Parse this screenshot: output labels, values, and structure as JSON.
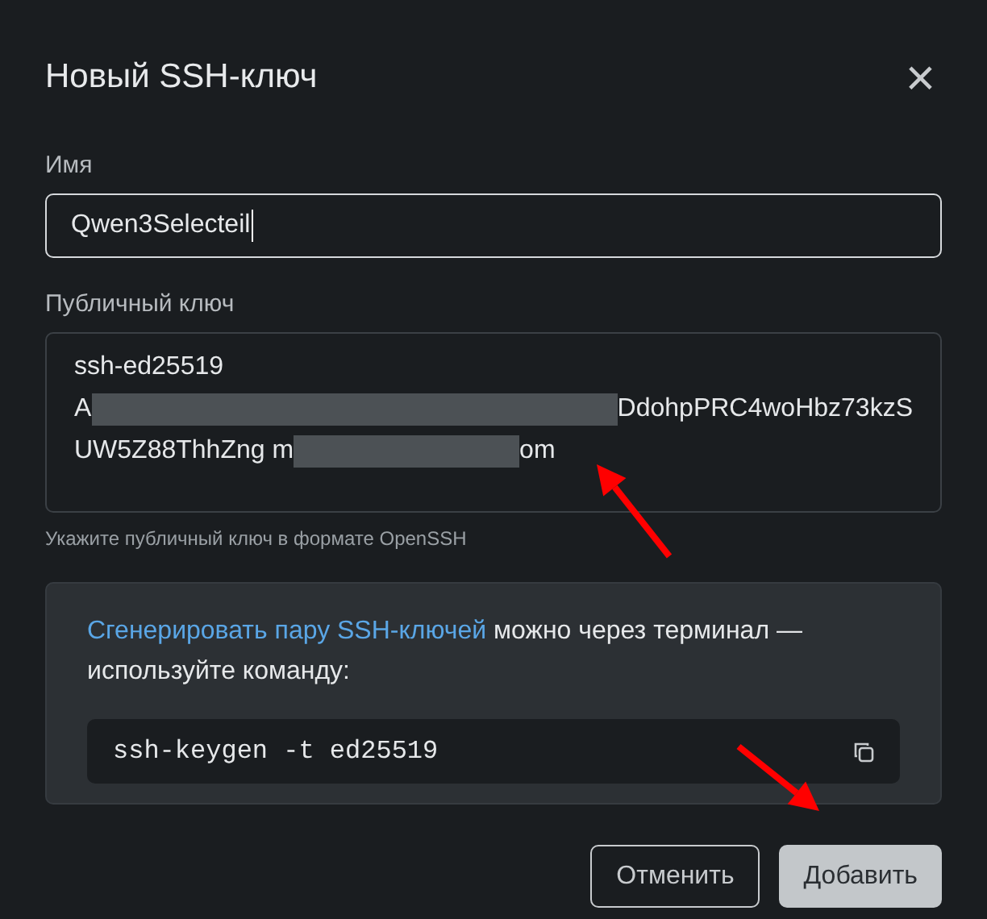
{
  "dialog": {
    "title": "Новый SSH-ключ",
    "close": "×"
  },
  "name_field": {
    "label": "Имя",
    "value": "Qwen3Selecteil",
    "focused": true
  },
  "key_field": {
    "label": "Публичный ключ",
    "lines": [
      [
        {
          "kind": "text",
          "text": "ssh-ed25519"
        }
      ],
      [
        {
          "kind": "text",
          "text": "A"
        },
        {
          "kind": "redacted"
        },
        {
          "kind": "text",
          "text": "DdohpPRC4woHbz73kzS"
        }
      ],
      [
        {
          "kind": "text",
          "text": "UW5Z88ThhZng m"
        },
        {
          "kind": "redacted"
        },
        {
          "kind": "text",
          "text": "om"
        }
      ]
    ],
    "hint": "Укажите публичный ключ в формате OpenSSH"
  },
  "info": {
    "link": "Сгенерировать пару SSH-ключей",
    "text": " можно через терминал — используйте команду:",
    "command": "ssh-keygen -t ed25519"
  },
  "buttons": [
    {
      "label": "Отменить",
      "kind": "secondary"
    },
    {
      "label": "Добавить",
      "kind": "primary"
    }
  ]
}
